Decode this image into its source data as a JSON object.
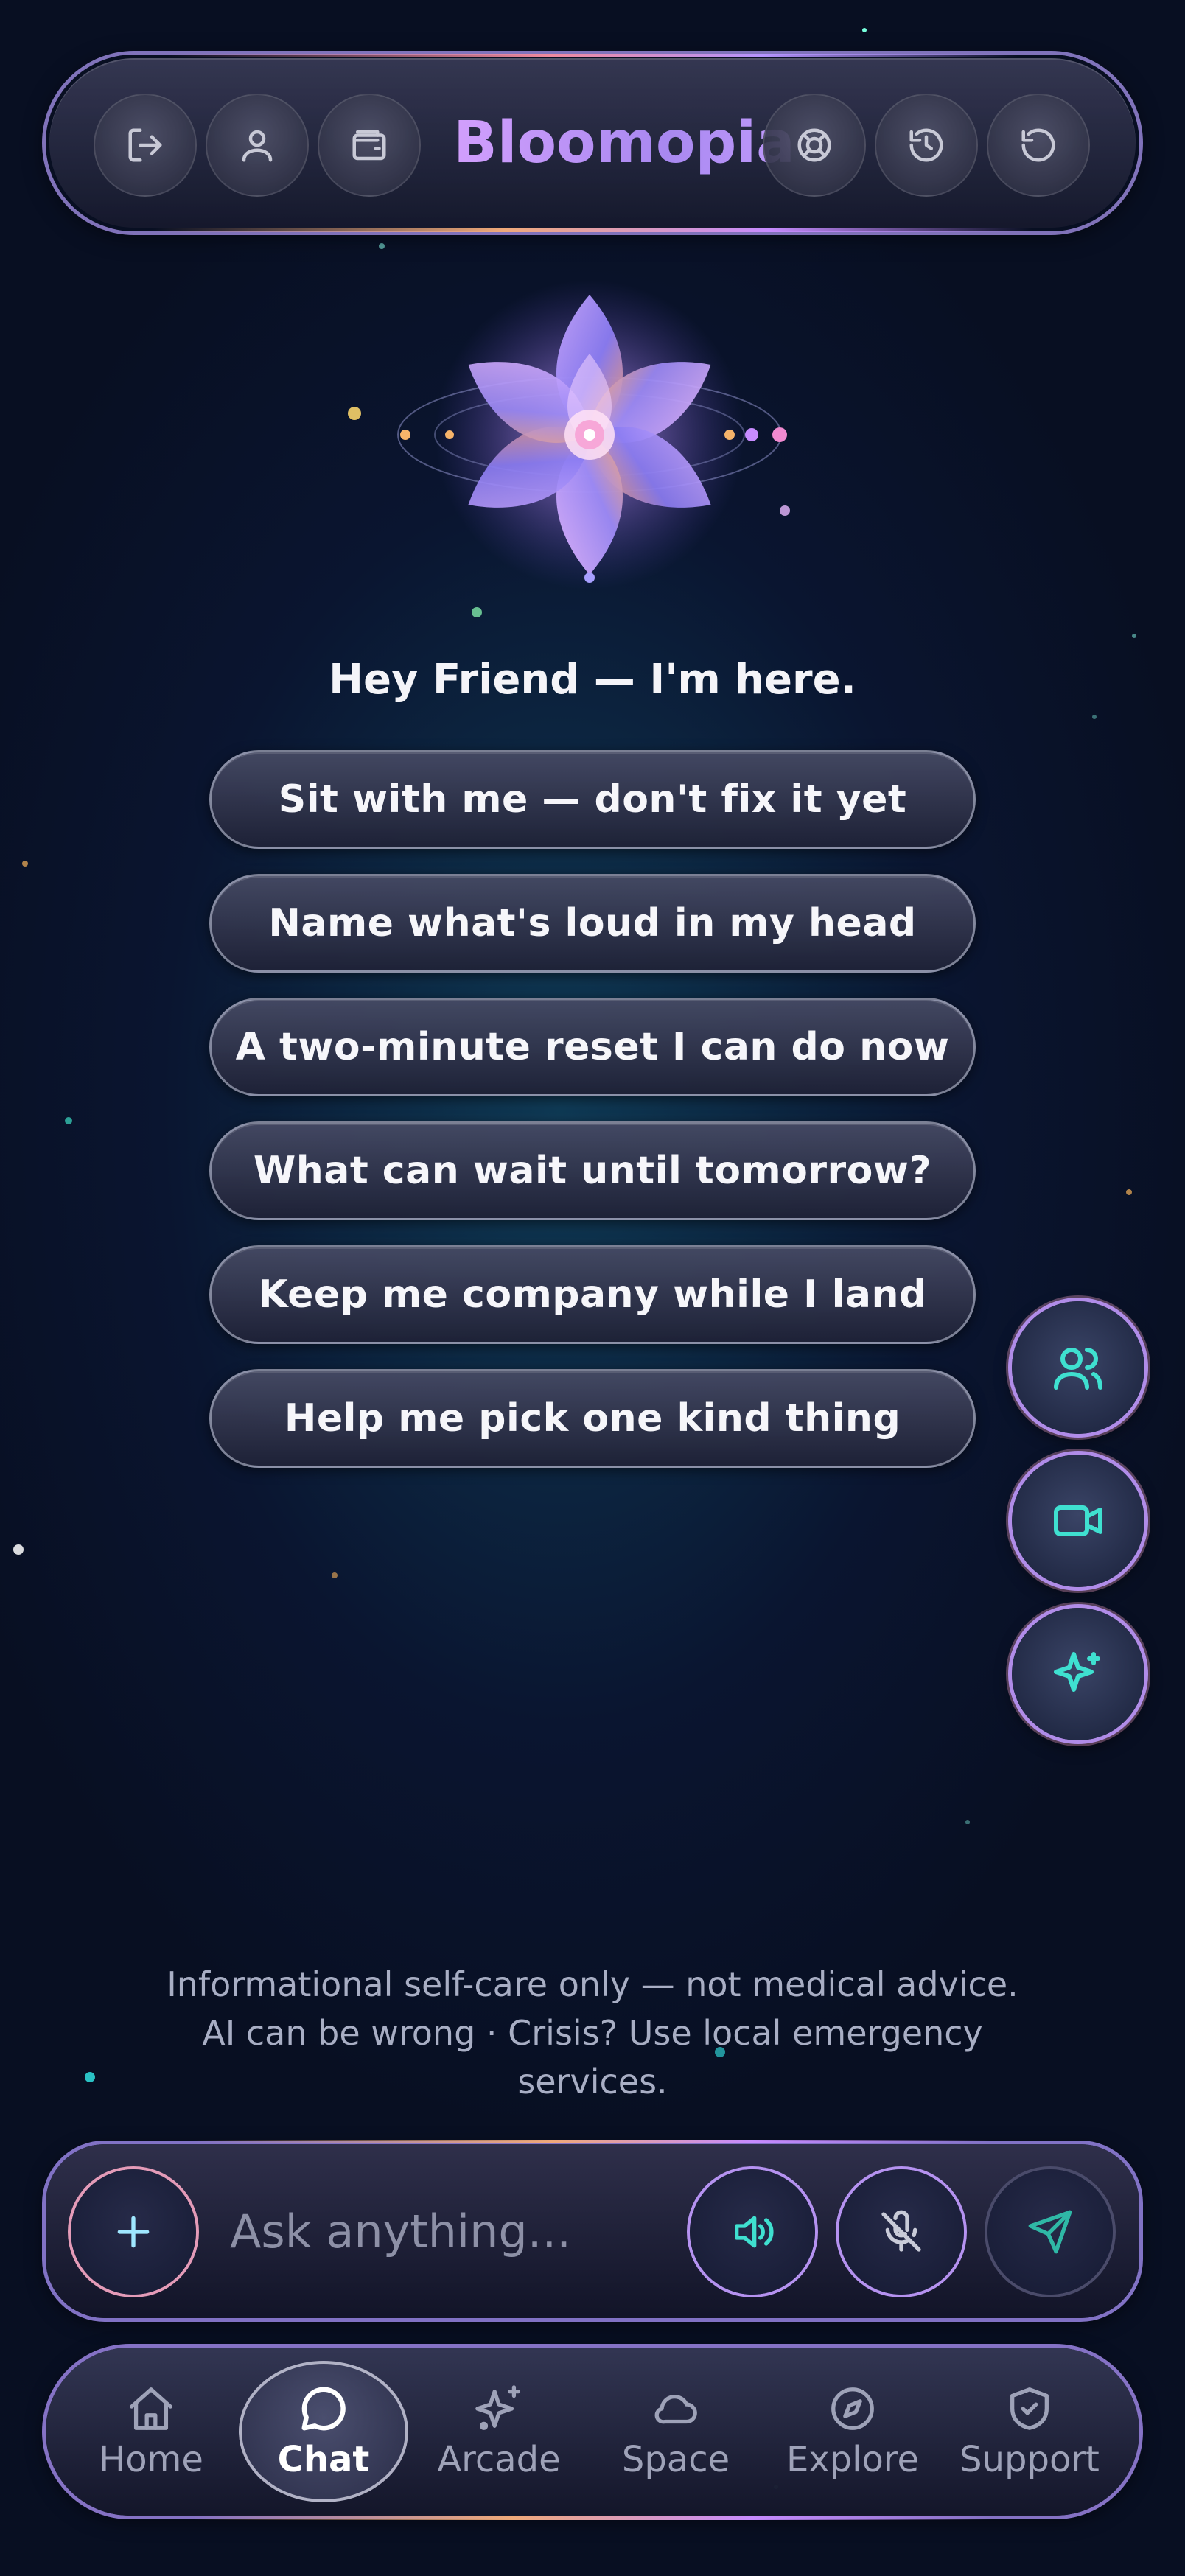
{
  "app": {
    "title": "Bloomopia"
  },
  "header": {
    "left_buttons": [
      "logout-icon",
      "user-icon",
      "wallet-icon"
    ],
    "right_buttons": [
      "lifebuoy-icon",
      "history-icon",
      "refresh-icon"
    ]
  },
  "main": {
    "greeting": "Hey Friend — I'm here.",
    "prompts": [
      "Sit with me — don't fix it yet",
      "Name what's loud in my head",
      "A two-minute reset I can do now",
      "What can wait until tomorrow?",
      "Keep me company while I land",
      "Help me pick one kind thing"
    ]
  },
  "floating_actions": [
    "users-icon",
    "video-icon",
    "sparkles-icon"
  ],
  "disclaimer": {
    "line1": "Informational self-care only — not medical advice.",
    "line2": "AI can be wrong · Crisis? Use local emergency",
    "line3": "services."
  },
  "composer": {
    "placeholder": "Ask anything...",
    "value": "",
    "buttons": [
      "plus-icon",
      "speaker-icon",
      "mic-off-icon",
      "send-icon"
    ]
  },
  "nav": {
    "items": [
      {
        "label": "Home",
        "icon": "home-icon",
        "active": false
      },
      {
        "label": "Chat",
        "icon": "chat-bubble-icon",
        "active": true
      },
      {
        "label": "Arcade",
        "icon": "sparkles-icon",
        "active": false
      },
      {
        "label": "Space",
        "icon": "cloud-icon",
        "active": false
      },
      {
        "label": "Explore",
        "icon": "compass-icon",
        "active": false
      },
      {
        "label": "Support",
        "icon": "shield-check-icon",
        "active": false
      }
    ]
  },
  "colors": {
    "brand_gradient_start": "#d9a3ff",
    "brand_gradient_end": "#a888f0",
    "accent_teal": "#3fe0d0",
    "ring_purple": "#b592f0"
  }
}
